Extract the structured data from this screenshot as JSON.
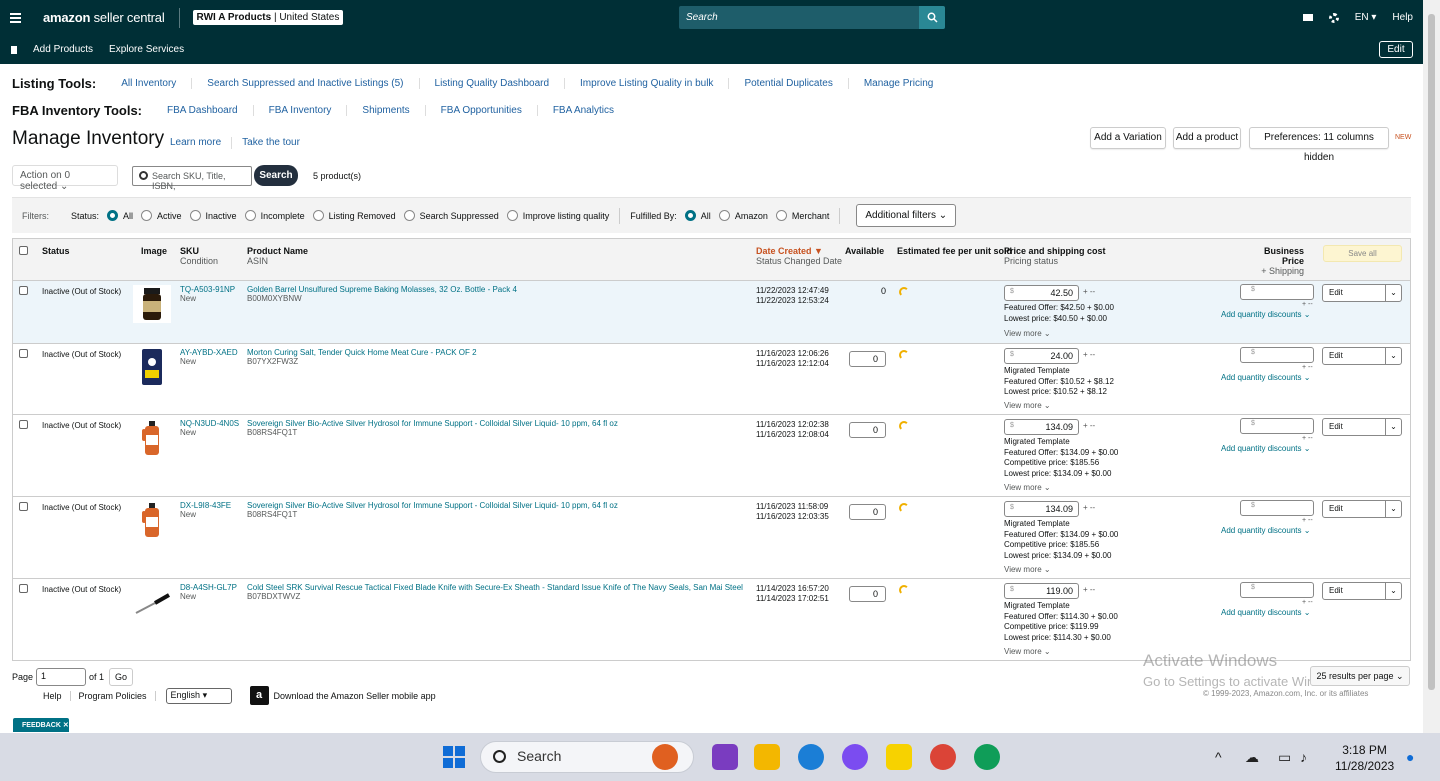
{
  "header": {
    "logo_main": "amazon",
    "logo_sub": "seller central",
    "account_name": "RWI A Products",
    "account_region": "United States",
    "search_placeholder": "Search",
    "language": "EN",
    "help": "Help"
  },
  "subbar": {
    "links": [
      "Add Products",
      "Explore Services"
    ],
    "edit_label": "Edit"
  },
  "listing_tools": {
    "title": "Listing Tools:",
    "links": [
      "All Inventory",
      "Search Suppressed and Inactive Listings (5)",
      "Listing Quality Dashboard",
      "Improve Listing Quality in bulk",
      "Potential Duplicates",
      "Manage Pricing"
    ]
  },
  "fba_tools": {
    "title": "FBA Inventory Tools:",
    "links": [
      "FBA Dashboard",
      "FBA Inventory",
      "Shipments",
      "FBA Opportunities",
      "FBA Analytics"
    ]
  },
  "page": {
    "title": "Manage Inventory",
    "learn_more": "Learn more",
    "take_tour": "Take the tour",
    "add_variation": "Add a Variation",
    "add_product": "Add a product",
    "preferences": "Preferences: 11 columns hidden",
    "new_badge": "NEW"
  },
  "toolbar": {
    "action_select": "Action on 0 selected",
    "search_placeholder": "Search SKU, Title, ISBN,",
    "search_button": "Search",
    "product_count": "5 product(s)"
  },
  "filters": {
    "label": "Filters:",
    "status_label": "Status:",
    "status_options": [
      "All",
      "Active",
      "Inactive",
      "Incomplete",
      "Listing Removed",
      "Search Suppressed",
      "Improve listing quality"
    ],
    "fulfilled_label": "Fulfilled By:",
    "fulfilled_options": [
      "All",
      "Amazon",
      "Merchant"
    ],
    "additional": "Additional filters"
  },
  "columns": {
    "status": "Status",
    "image": "Image",
    "sku": "SKU",
    "condition": "Condition",
    "product_name": "Product Name",
    "asin": "ASIN",
    "date_created": "Date Created",
    "status_changed": "Status Changed Date",
    "available": "Available",
    "est_fee": "Estimated fee per unit sold",
    "price": "Price and shipping cost",
    "pricing_status": "Pricing status",
    "business_price": "Business Price",
    "plus_shipping": "+ Shipping",
    "save_all": "Save all"
  },
  "rows": [
    {
      "status": "Inactive (Out of Stock)",
      "sku": "TQ-A503-91NP",
      "condition": "New",
      "name": "Golden Barrel Unsulfured Supreme Baking Molasses, 32 Oz. Bottle - Pack 4",
      "asin": "B00M0XYBNW",
      "date_created": "11/22/2023 12:47:49",
      "status_changed": "11/22/2023 12:53:24",
      "available": "0",
      "price": "42.50",
      "info": [
        "Featured Offer: $42.50 + $0.00",
        "Lowest price: $40.50 + $0.00"
      ],
      "view_more": "View more",
      "qty_discounts": "Add quantity discounts",
      "edit": "Edit"
    },
    {
      "status": "Inactive (Out of Stock)",
      "sku": "AY-AYBD-XAED",
      "condition": "New",
      "name": "Morton Curing Salt, Tender Quick Home Meat Cure - PACK OF 2",
      "asin": "B07YX2FW3Z",
      "date_created": "11/16/2023 12:06:26",
      "status_changed": "11/16/2023 12:12:04",
      "available": "0",
      "price": "24.00",
      "info": [
        "Migrated Template",
        "Featured Offer: $10.52 + $8.12",
        "Lowest price: $10.52 + $8.12"
      ],
      "view_more": "View more",
      "qty_discounts": "Add quantity discounts",
      "edit": "Edit"
    },
    {
      "status": "Inactive (Out of Stock)",
      "sku": "NQ-N3UD-4N0S",
      "condition": "New",
      "name": "Sovereign Silver Bio-Active Silver Hydrosol for Immune Support - Colloidal Silver Liquid- 10 ppm, 64 fl oz",
      "asin": "B08RS4FQ1T",
      "date_created": "11/16/2023 12:02:38",
      "status_changed": "11/16/2023 12:08:04",
      "available": "0",
      "price": "134.09",
      "info": [
        "Migrated Template",
        "Featured Offer: $134.09 + $0.00",
        "Competitive price: $185.56",
        "Lowest price: $134.09 + $0.00"
      ],
      "view_more": "View more",
      "qty_discounts": "Add quantity discounts",
      "edit": "Edit"
    },
    {
      "status": "Inactive (Out of Stock)",
      "sku": "DX-L9I8-43FE",
      "condition": "New",
      "name": "Sovereign Silver Bio-Active Silver Hydrosol for Immune Support - Colloidal Silver Liquid- 10 ppm, 64 fl oz",
      "asin": "B08RS4FQ1T",
      "date_created": "11/16/2023 11:58:09",
      "status_changed": "11/16/2023 12:03:35",
      "available": "0",
      "price": "134.09",
      "info": [
        "Migrated Template",
        "Featured Offer: $134.09 + $0.00",
        "Competitive price: $185.56",
        "Lowest price: $134.09 + $0.00"
      ],
      "view_more": "View more",
      "qty_discounts": "Add quantity discounts",
      "edit": "Edit"
    },
    {
      "status": "Inactive (Out of Stock)",
      "sku": "D8-A4SH-GL7P",
      "condition": "New",
      "name": "Cold Steel SRK Survival Rescue Tactical Fixed Blade Knife with Secure-Ex Sheath - Standard Issue Knife of The Navy Seals, San Mai Steel",
      "asin": "B07BDXTWVZ",
      "date_created": "11/14/2023 16:57:20",
      "status_changed": "11/14/2023 17:02:51",
      "available": "0",
      "price": "119.00",
      "info": [
        "Migrated Template",
        "Featured Offer: $114.30 + $0.00",
        "Competitive price: $119.99",
        "Lowest price: $114.30 + $0.00"
      ],
      "view_more": "View more",
      "qty_discounts": "Add quantity discounts",
      "edit": "Edit"
    }
  ],
  "pager": {
    "page_label": "Page",
    "page_value": "1",
    "of_label": "of 1",
    "go": "Go",
    "results_per_page": "25 results per page"
  },
  "footer": {
    "help": "Help",
    "policies": "Program Policies",
    "language": "English",
    "download": "Download the Amazon Seller mobile app",
    "copyright": "© 1999-2023, Amazon.com, Inc. or its affiliates",
    "feedback": "FEEDBACK"
  },
  "watermark": {
    "line1": "Activate Windows",
    "line2": "Go to Settings to activate Windows."
  },
  "taskbar": {
    "search": "Search",
    "time": "3:18 PM",
    "date": "11/28/2023"
  },
  "colors": {
    "header_bg": "#002f36",
    "link": "#007185",
    "sort_accent": "#c7511f"
  }
}
